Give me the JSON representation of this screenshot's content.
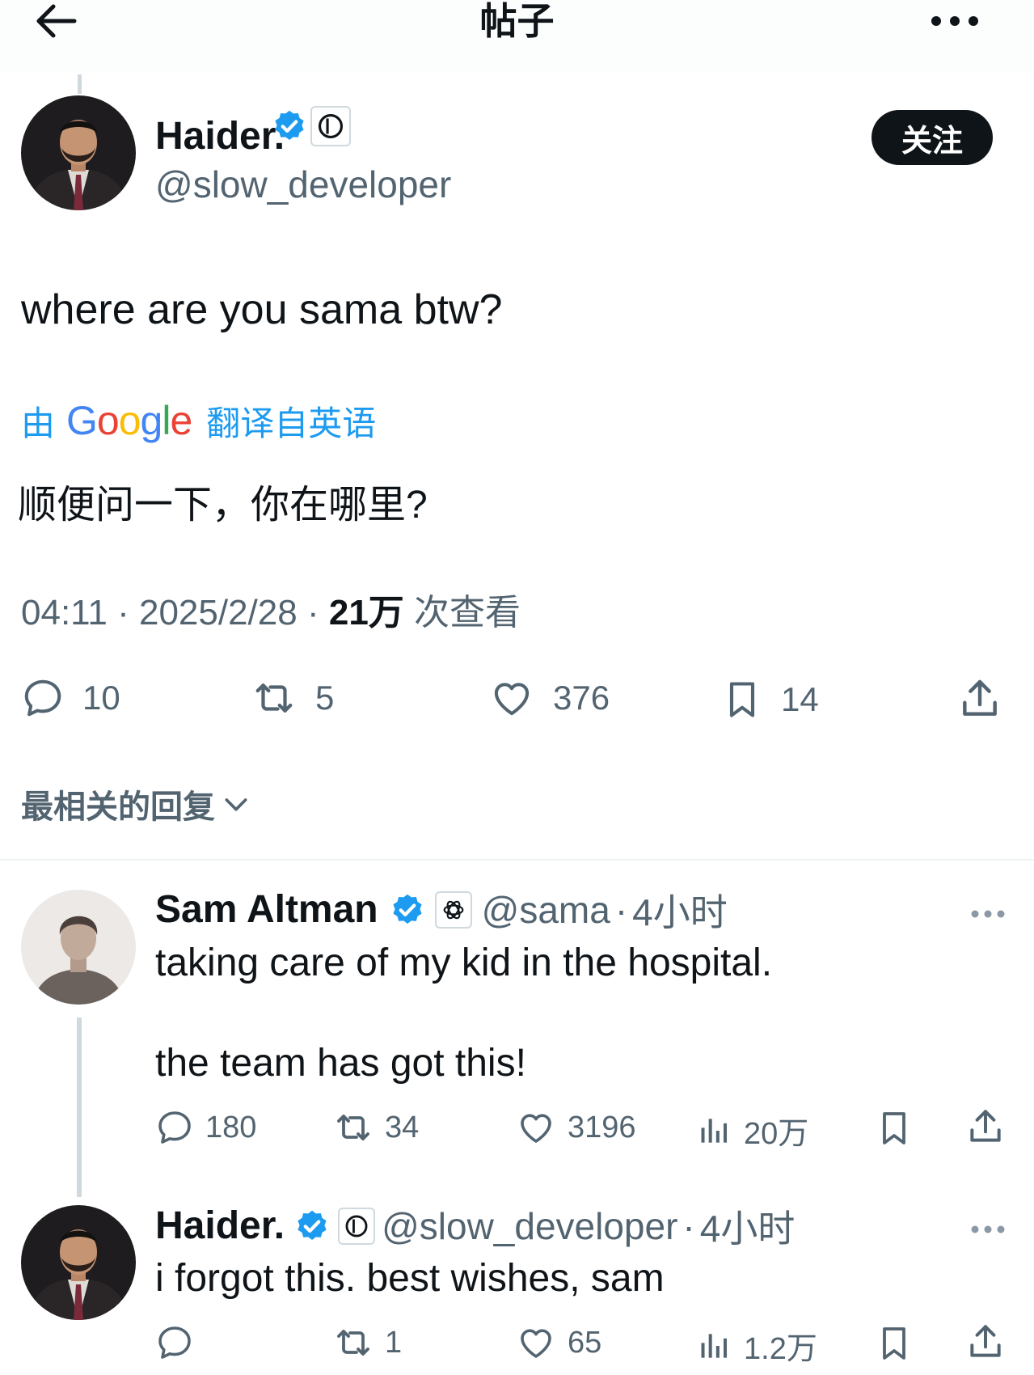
{
  "header": {
    "title": "帖子",
    "back_icon": "arrow-left-icon",
    "more_icon": "more-horizontal-icon"
  },
  "main_tweet": {
    "author": {
      "name": "Haider.",
      "handle": "@slow_developer",
      "verified": true,
      "affiliation_icon": "circle-badge-icon"
    },
    "follow_label": "关注",
    "text": "where are you sama btw?",
    "translation": {
      "by_label": "由",
      "provider": "Google",
      "from_label": "翻译自英语",
      "text": "顺便问一下，你在哪里?"
    },
    "meta": {
      "time": "04:11",
      "sep1": "·",
      "date": "2025/2/28",
      "sep2": "·",
      "views_count": "21万",
      "views_label": "次查看"
    },
    "actions": {
      "replies": "10",
      "reposts": "5",
      "likes": "376",
      "bookmarks": "14"
    }
  },
  "replies_sort": {
    "label": "最相关的回复"
  },
  "replies": [
    {
      "name": "Sam Altman",
      "handle": "@sama",
      "sep": "·",
      "time": "4小时",
      "verified": true,
      "affiliation_icon": "openai-logo-icon",
      "text_line1": "taking care of my kid in the hospital.",
      "text_line2": "the team has got this!",
      "actions": {
        "replies": "180",
        "reposts": "34",
        "likes": "3196",
        "views": "20万"
      }
    },
    {
      "name": "Haider.",
      "handle": "@slow_developer",
      "sep": "·",
      "time": "4小时",
      "verified": true,
      "affiliation_icon": "circle-badge-icon",
      "text_line1": "i forgot this. best wishes, sam",
      "actions": {
        "replies": "",
        "reposts": "1",
        "likes": "65",
        "views": "1.2万"
      }
    }
  ],
  "colors": {
    "accent": "#1d9bf0",
    "text": "#0f1419",
    "muted": "#536471",
    "verified": "#1d9bf0"
  }
}
